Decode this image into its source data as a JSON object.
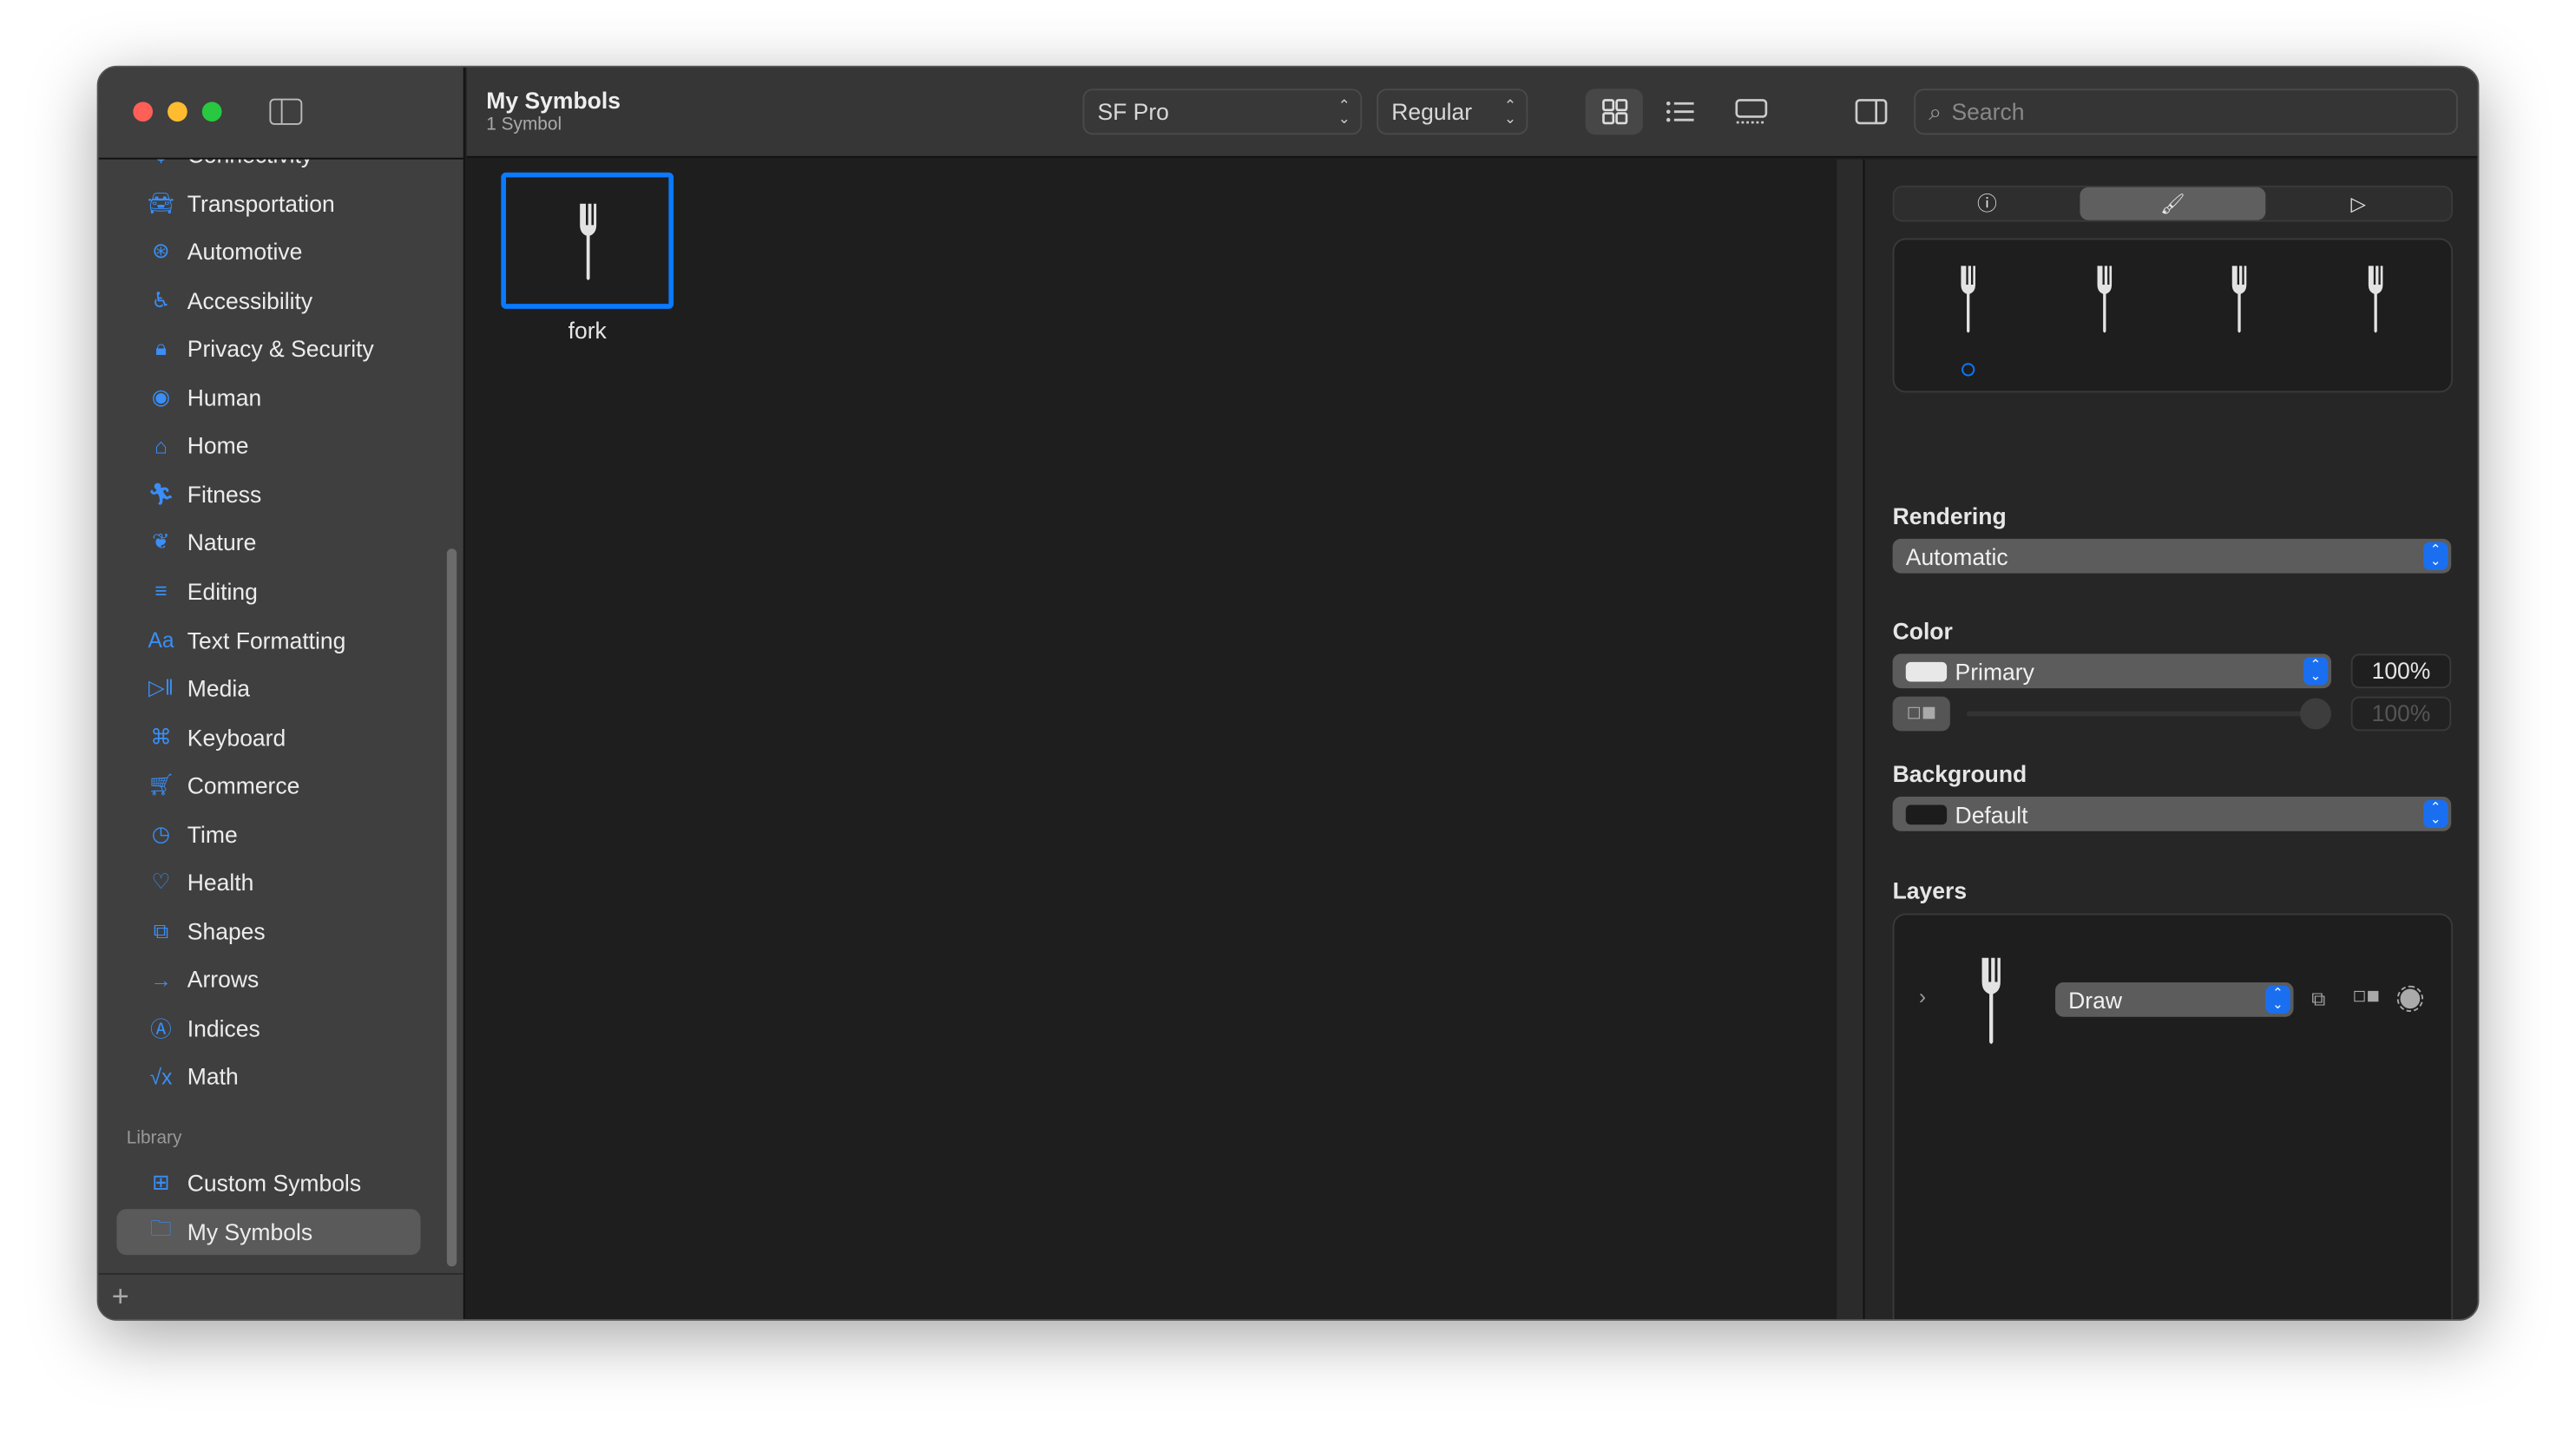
{
  "window": {
    "title": "My Symbols",
    "subtitle": "1 Symbol"
  },
  "toolbar": {
    "font": "SF Pro",
    "weight": "Regular",
    "search_placeholder": "Search",
    "views": [
      "grid-view",
      "list-view",
      "gallery-view"
    ],
    "active_view": "grid-view"
  },
  "sidebar": {
    "items": [
      {
        "label": "Connectivity",
        "icon": "antenna-icon"
      },
      {
        "label": "Transportation",
        "icon": "car-icon"
      },
      {
        "label": "Automotive",
        "icon": "steering-wheel-icon"
      },
      {
        "label": "Accessibility",
        "icon": "accessibility-icon"
      },
      {
        "label": "Privacy & Security",
        "icon": "lock-icon"
      },
      {
        "label": "Human",
        "icon": "person-icon"
      },
      {
        "label": "Home",
        "icon": "house-icon"
      },
      {
        "label": "Fitness",
        "icon": "figure-run-icon"
      },
      {
        "label": "Nature",
        "icon": "leaf-icon"
      },
      {
        "label": "Editing",
        "icon": "sliders-icon"
      },
      {
        "label": "Text Formatting",
        "icon": "textformat-icon"
      },
      {
        "label": "Media",
        "icon": "play-pause-icon"
      },
      {
        "label": "Keyboard",
        "icon": "command-icon"
      },
      {
        "label": "Commerce",
        "icon": "cart-icon"
      },
      {
        "label": "Time",
        "icon": "clock-icon"
      },
      {
        "label": "Health",
        "icon": "heart-icon"
      },
      {
        "label": "Shapes",
        "icon": "shapes-icon"
      },
      {
        "label": "Arrows",
        "icon": "arrow-right-icon"
      },
      {
        "label": "Indices",
        "icon": "circle-a-icon"
      },
      {
        "label": "Math",
        "icon": "sqrt-icon"
      }
    ],
    "library_header": "Library",
    "library": [
      {
        "label": "Custom Symbols",
        "icon": "grid-icon"
      },
      {
        "label": "My Symbols",
        "icon": "folder-icon",
        "selected": true
      }
    ]
  },
  "symbols": [
    {
      "name": "fork",
      "selected": true
    }
  ],
  "inspector": {
    "tabs": [
      "info-icon",
      "paintbrush-icon",
      "play-icon"
    ],
    "active_tab": 1,
    "rendering_label": "Rendering",
    "rendering": "Automatic",
    "color_label": "Color",
    "color": "Primary",
    "color_opacity": "100%",
    "secondary_opacity": "100%",
    "secondary_slider": 1.0,
    "background_label": "Background",
    "background": "Default",
    "layers_label": "Layers",
    "layers": [
      {
        "mode": "Draw"
      }
    ]
  },
  "colors": {
    "accent": "#0a7aff",
    "sidebar_icon": "#3a8ef6"
  }
}
